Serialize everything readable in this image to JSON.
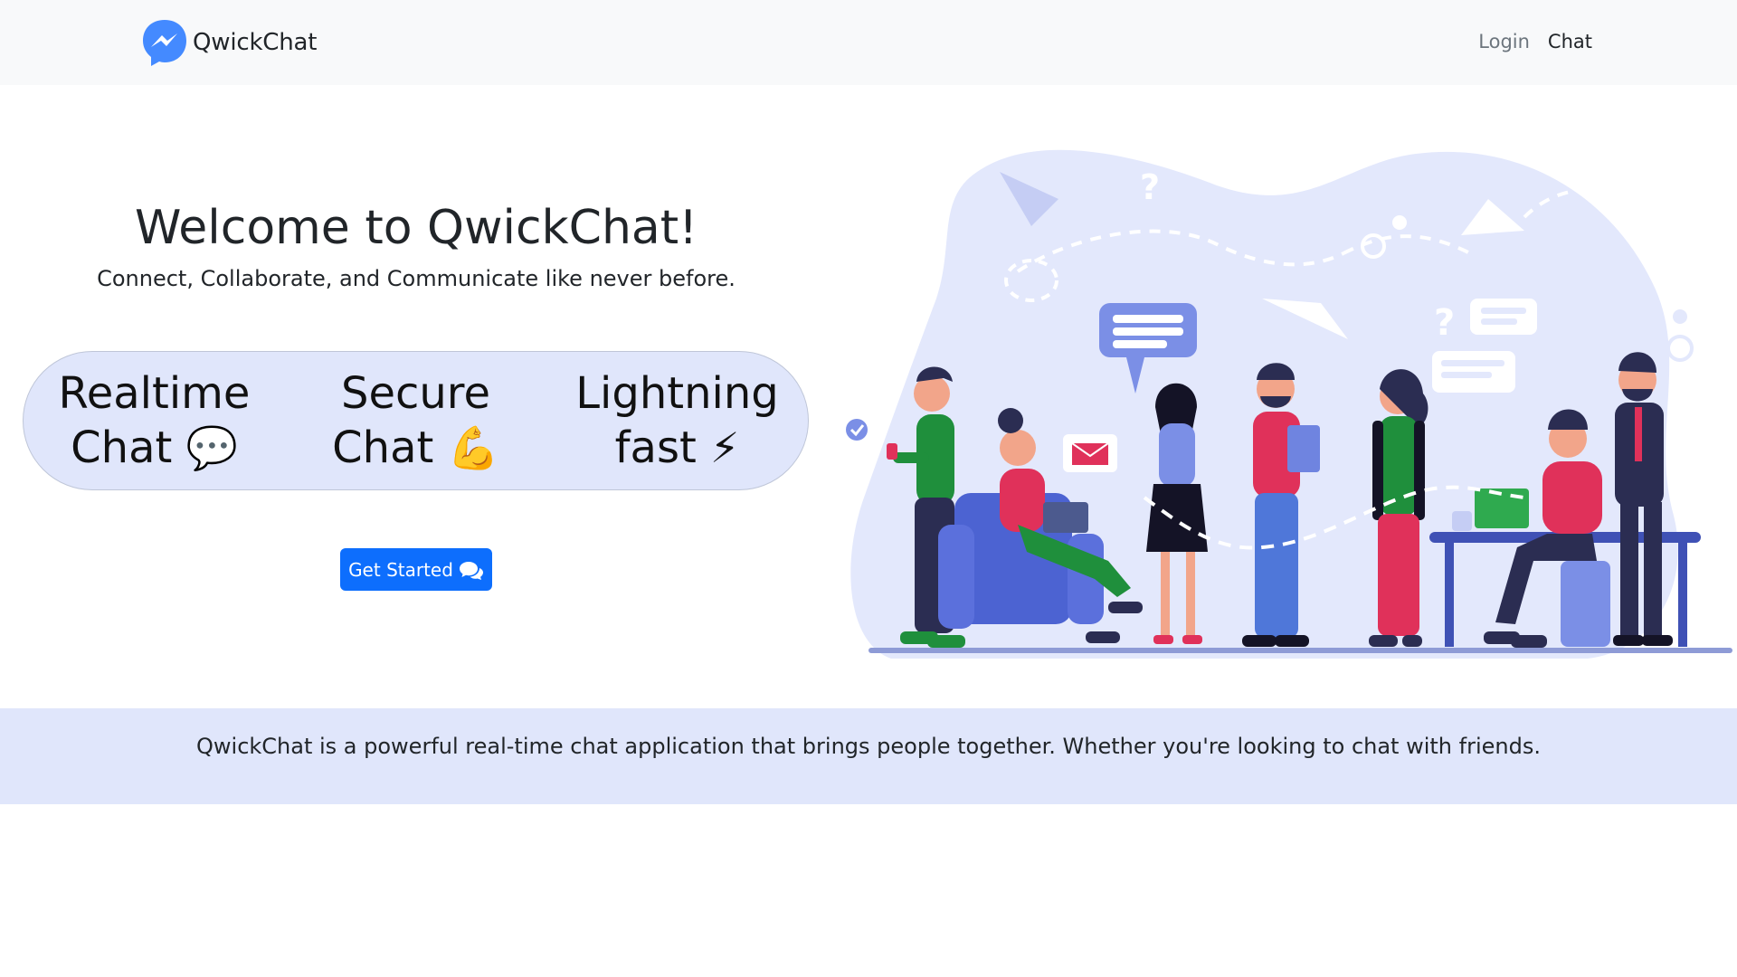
{
  "navbar": {
    "brand_name": "QwickChat",
    "logo_icon": "messenger-logo-icon",
    "links": {
      "login": "Login",
      "chat": "Chat"
    }
  },
  "hero": {
    "title": "Welcome to QwickChat!",
    "subtitle": "Connect, Collaborate, and Communicate like never before.",
    "features": [
      {
        "line1": "Realtime",
        "line2": "Chat",
        "emoji": "💬",
        "icon": "speech-bubble-icon"
      },
      {
        "line1": "Secure",
        "line2": "Chat",
        "emoji": "💪",
        "icon": "flexed-biceps-icon"
      },
      {
        "line1": "Lightning",
        "line2": "fast",
        "emoji": "⚡",
        "icon": "lightning-icon"
      }
    ],
    "cta": {
      "label": "Get Started",
      "icon": "chat-bubbles-icon"
    },
    "illustration": "people-chatting-illustration"
  },
  "about": {
    "text": "QwickChat is a powerful real-time chat application that brings people together. Whether you're looking to chat with friends."
  },
  "colors": {
    "navbar_bg": "#f8f9fa",
    "feature_pill_bg": "#e0e6fb",
    "primary_button": "#0d6efd",
    "about_band_bg": "#e0e6fb",
    "illustration_bg": "#e3e8fc"
  }
}
